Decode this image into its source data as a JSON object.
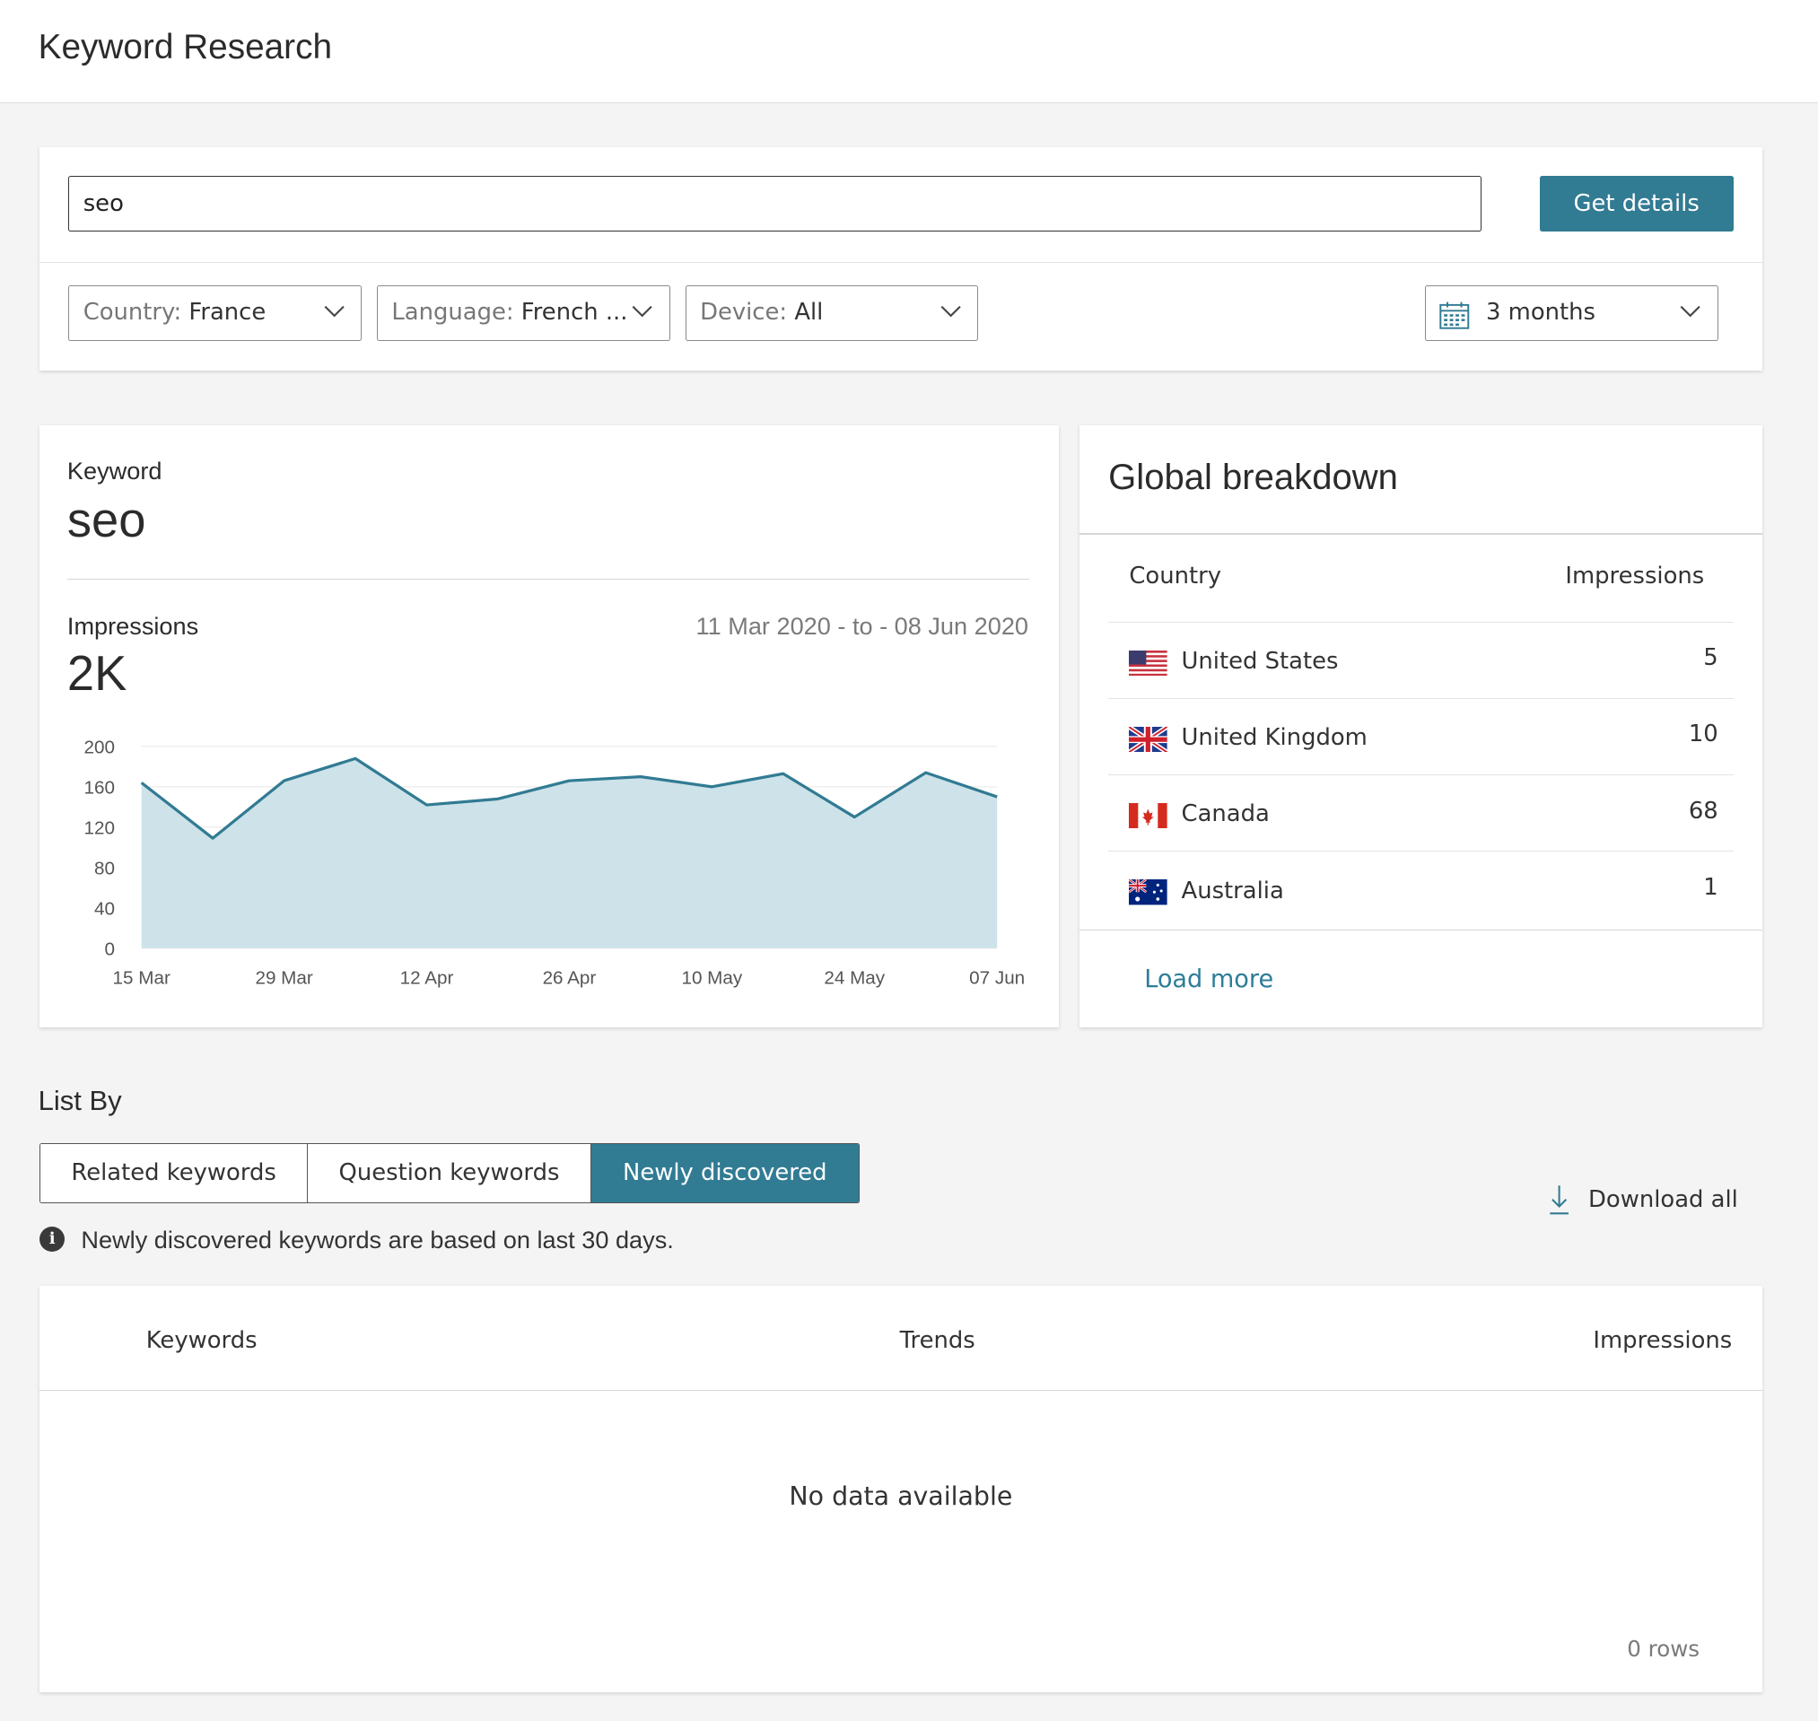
{
  "page": {
    "title": "Keyword Research"
  },
  "search": {
    "value": "seo",
    "button_label": "Get details"
  },
  "filters": {
    "country": {
      "label": "Country:",
      "value": "France"
    },
    "language": {
      "label": "Language:",
      "value": "French ..."
    },
    "device": {
      "label": "Device:",
      "value": "All"
    },
    "period": {
      "value": "3 months",
      "icon": "calendar-icon"
    }
  },
  "keyword_card": {
    "keyword_label": "Keyword",
    "keyword": "seo",
    "impressions_label": "Impressions",
    "impressions_value": "2K",
    "date_range": "11 Mar 2020 - to - 08 Jun 2020"
  },
  "chart_data": {
    "type": "area",
    "x": [
      "15 Mar",
      "22 Mar",
      "29 Mar",
      "05 Apr",
      "12 Apr",
      "19 Apr",
      "26 Apr",
      "03 May",
      "10 May",
      "17 May",
      "24 May",
      "31 May",
      "07 Jun"
    ],
    "values": [
      164,
      109,
      166,
      188,
      142,
      148,
      166,
      170,
      160,
      173,
      130,
      174,
      150
    ],
    "x_tick_labels": [
      "15 Mar",
      "29 Mar",
      "12 Apr",
      "26 Apr",
      "10 May",
      "24 May",
      "07 Jun"
    ],
    "y_ticks": [
      0,
      40,
      80,
      120,
      160,
      200
    ],
    "ylim": [
      0,
      200
    ],
    "grid": true,
    "colors": {
      "line": "#317b93",
      "fill": "#cde2e9"
    }
  },
  "global_breakdown": {
    "title": "Global breakdown",
    "col_country": "Country",
    "col_impressions": "Impressions",
    "rows": [
      {
        "country": "United States",
        "impressions": "5",
        "flag": "us-flag-icon"
      },
      {
        "country": "United Kingdom",
        "impressions": "10",
        "flag": "uk-flag-icon"
      },
      {
        "country": "Canada",
        "impressions": "68",
        "flag": "canada-flag-icon"
      },
      {
        "country": "Australia",
        "impressions": "1",
        "flag": "australia-flag-icon"
      }
    ],
    "load_more": "Load more"
  },
  "list_by": {
    "title": "List By",
    "tabs": [
      {
        "label": "Related keywords"
      },
      {
        "label": "Question keywords"
      },
      {
        "label": "Newly discovered"
      }
    ],
    "active_tab": "Newly discovered",
    "info_text": "Newly discovered keywords are based on last 30 days.",
    "download_label": "Download all"
  },
  "table": {
    "col_keywords": "Keywords",
    "col_trends": "Trends",
    "col_impressions": "Impressions",
    "empty_text": "No data available",
    "row_count": "0 rows"
  },
  "colors": {
    "accent": "#317b93",
    "link": "#2e7d98",
    "background": "#f4f4f4"
  }
}
